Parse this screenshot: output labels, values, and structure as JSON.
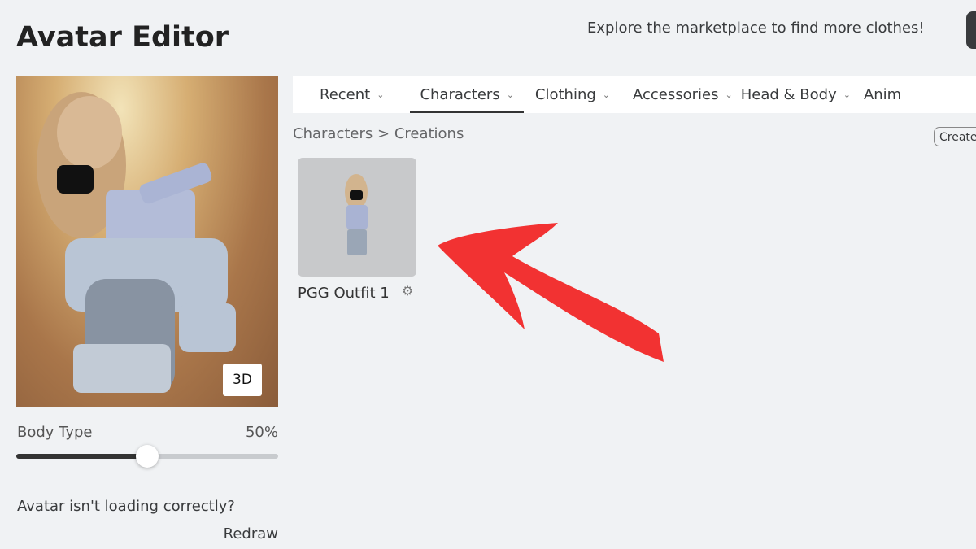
{
  "header": {
    "title": "Avatar Editor",
    "explore_text": "Explore the marketplace to find more clothes!"
  },
  "preview": {
    "view_toggle": "3D"
  },
  "body_type": {
    "label": "Body Type",
    "value_label": "50%",
    "value": 50
  },
  "loading": {
    "question": "Avatar isn't loading correctly?",
    "redraw": "Redraw"
  },
  "tabs": [
    {
      "label": "Recent",
      "active": false
    },
    {
      "label": "Characters",
      "active": true
    },
    {
      "label": "Clothing",
      "active": false
    },
    {
      "label": "Accessories",
      "active": false
    },
    {
      "label": "Head & Body",
      "active": false
    },
    {
      "label": "Anim",
      "active": false
    }
  ],
  "breadcrumb": {
    "parent": "Characters",
    "separator": ">",
    "current": "Creations"
  },
  "create_button": "Create",
  "outfits": [
    {
      "name": "PGG Outfit 1",
      "icon": "gear-icon"
    }
  ],
  "annotation": {
    "arrow_color": "#f23232"
  }
}
